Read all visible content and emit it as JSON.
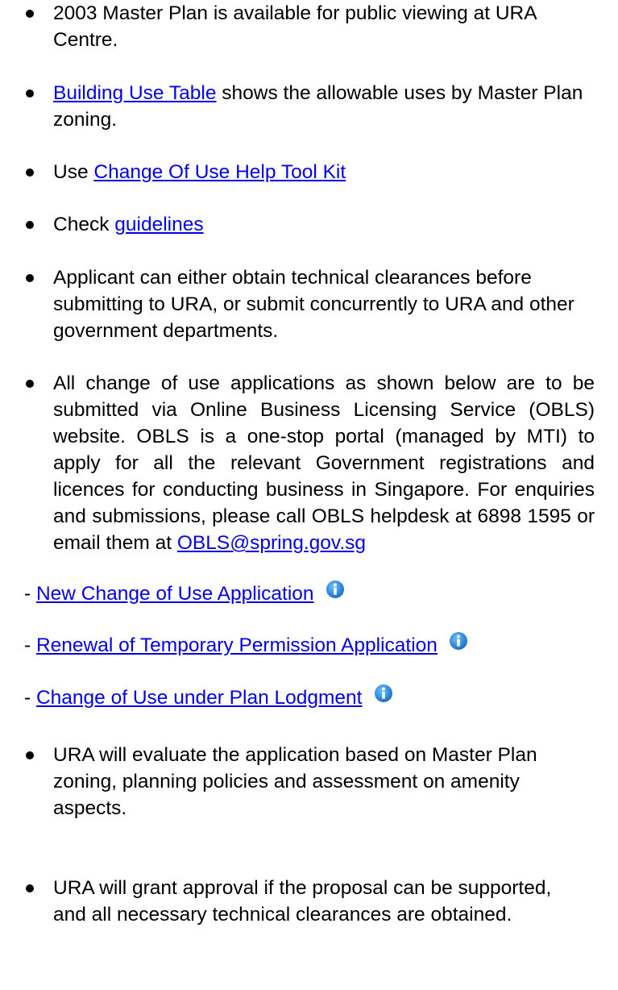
{
  "bullets_top": [
    {
      "pre": "2003 Master Plan is available for public viewing at URA Centre."
    },
    {
      "pre": "",
      "link": "Building Use Table",
      "post": " shows the allowable uses by Master Plan zoning."
    },
    {
      "pre": "Use ",
      "link": "Change Of Use Help Tool Kit",
      "post": ""
    },
    {
      "pre": "Check ",
      "link": "guidelines",
      "post": ""
    },
    {
      "pre": "Applicant can either obtain technical clearances before submitting to URA, or submit concurrently to URA and other government departments."
    },
    {
      "pre": "All change of use applications as shown below are to be submitted via Online Business Licensing Service (OBLS) website. OBLS is a one-stop portal (managed by MTI) to apply for all the relevant Government registrations and licences for conducting business in Singapore. For enquiries and submissions, please call OBLS helpdesk at 6898 1595 or email them at ",
      "link": "OBLS@spring.gov.sg",
      "post": ""
    }
  ],
  "application_links": [
    {
      "prefix": "- ",
      "label": "New Change of Use Application"
    },
    {
      "prefix": "- ",
      "label": "Renewal of Temporary Permission Application"
    },
    {
      "prefix": "- ",
      "label": "Change of Use under Plan Lodgment"
    }
  ],
  "bullets_bottom": [
    {
      "pre": "URA will evaluate the application based on Master Plan zoning, planning policies and assessment on amenity aspects."
    },
    {
      "pre": "URA will grant approval if the proposal can be supported, and all necessary technical clearances are obtained."
    }
  ],
  "colors": {
    "link": "#0000ee",
    "info_icon": "#1a7fd6"
  }
}
